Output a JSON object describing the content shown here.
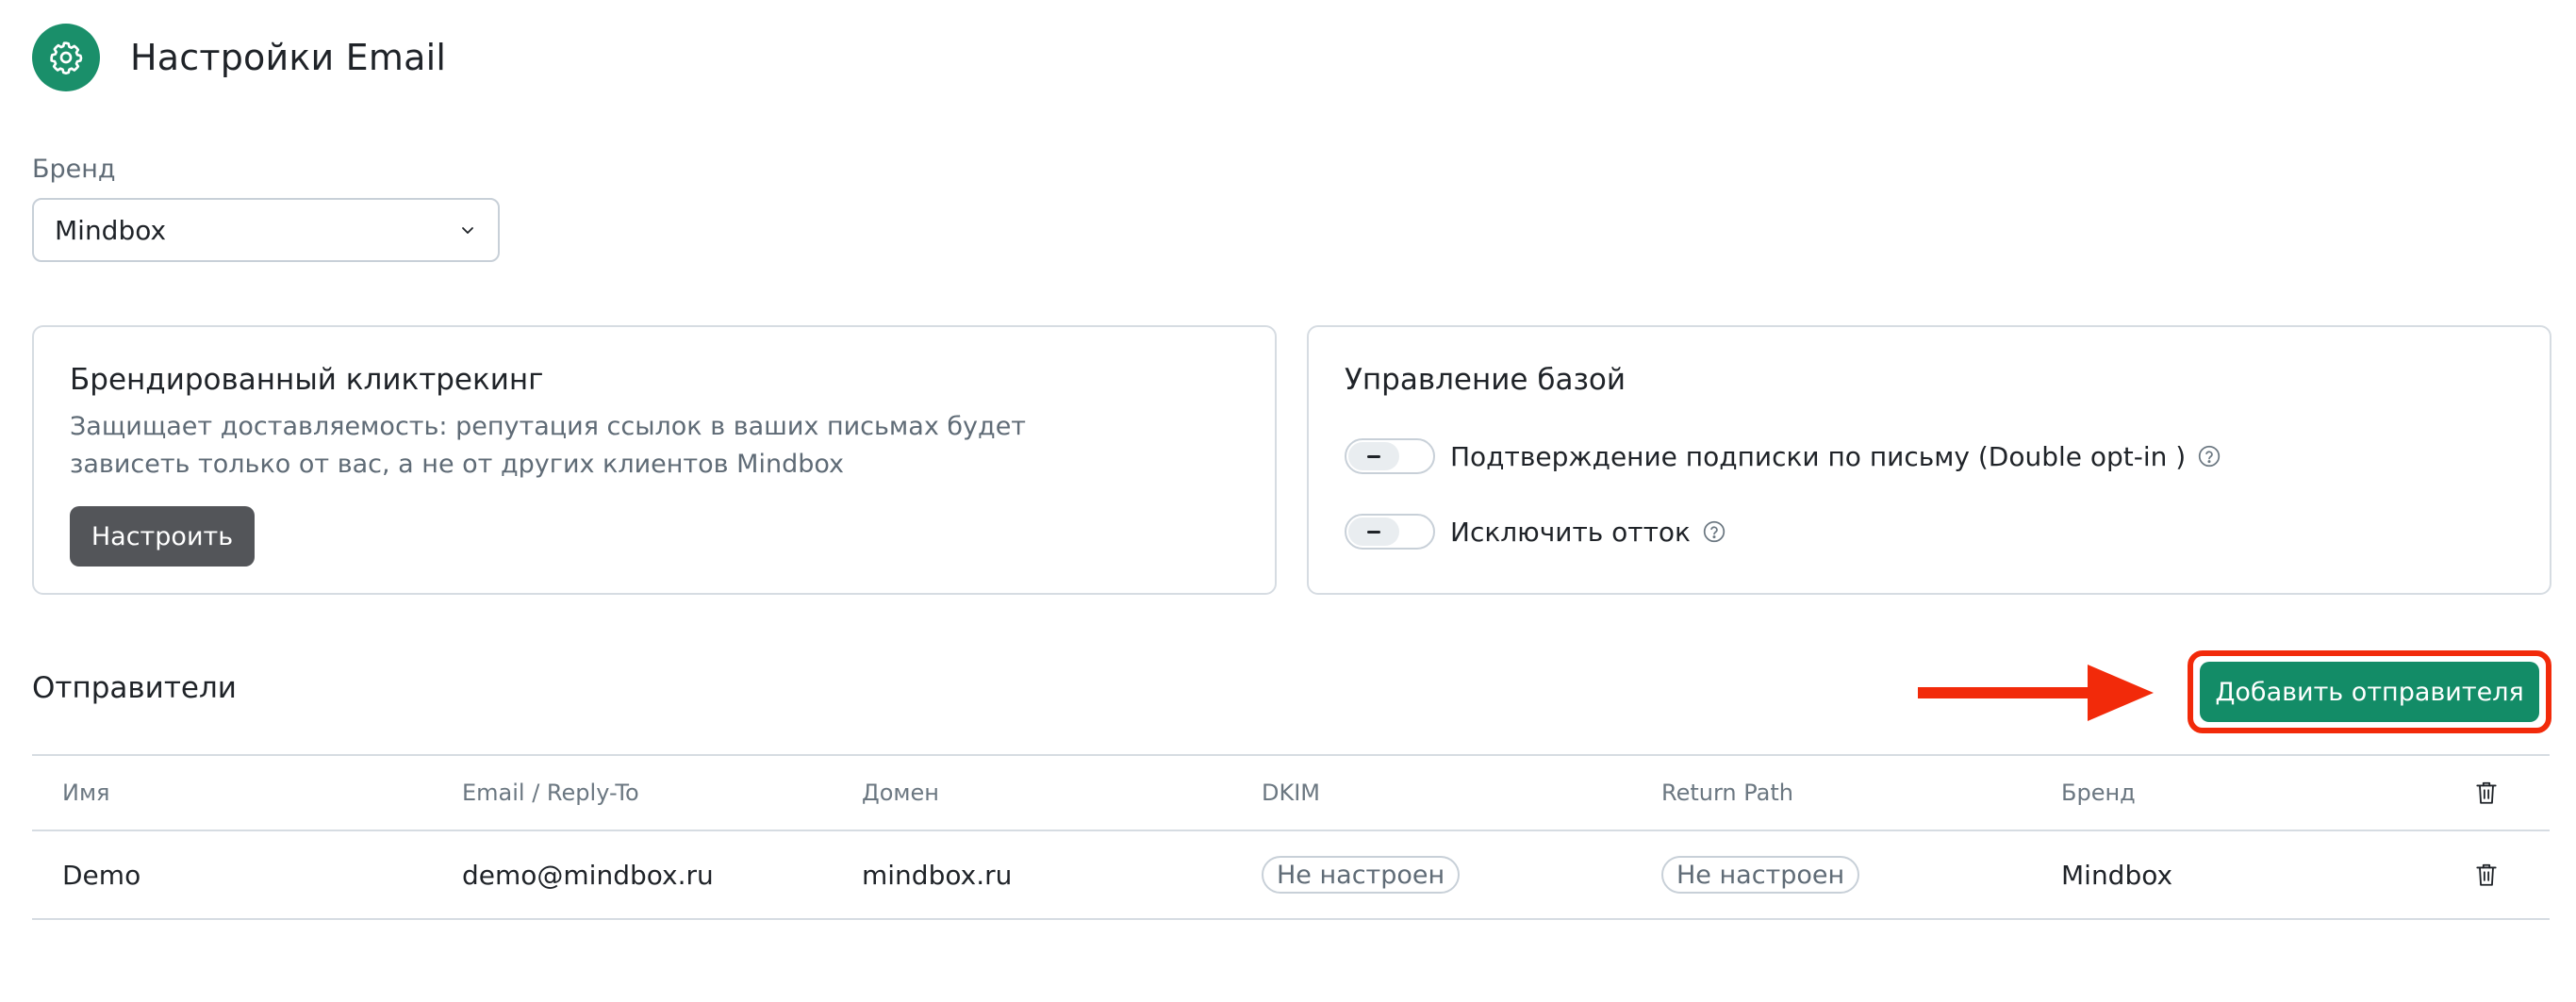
{
  "header": {
    "title": "Настройки Email",
    "icon": "gear-icon",
    "accent": "#1a8f6a"
  },
  "brand": {
    "label": "Бренд",
    "selected": "Mindbox"
  },
  "click_tracking": {
    "title": "Брендированный кликтрекинг",
    "description": "Защищает доставляемость: репутация ссылок в ваших письмах будет зависеть только от вас, а не от других клиентов Mindbox",
    "button_label": "Настроить"
  },
  "base_management": {
    "title": "Управление базой",
    "toggles": [
      {
        "label": "Подтверждение подписки по письму (Double opt-in )",
        "state": "indeterminate"
      },
      {
        "label": "Исключить отток",
        "state": "indeterminate"
      }
    ]
  },
  "senders": {
    "title": "Отправители",
    "add_button_label": "Добавить отправителя",
    "columns": [
      "Имя",
      "Email / Reply-To",
      "Домен",
      "DKIM",
      "Return Path",
      "Бренд"
    ],
    "rows": [
      {
        "name": "Demo",
        "email": "demo@mindbox.ru",
        "domain": "mindbox.ru",
        "dkim": "Не настроен",
        "return_path": "Не настроен",
        "brand": "Mindbox"
      }
    ]
  },
  "colors": {
    "primary_green": "#138c67",
    "highlight_red": "#f22a0a",
    "dark_button": "#535559"
  }
}
